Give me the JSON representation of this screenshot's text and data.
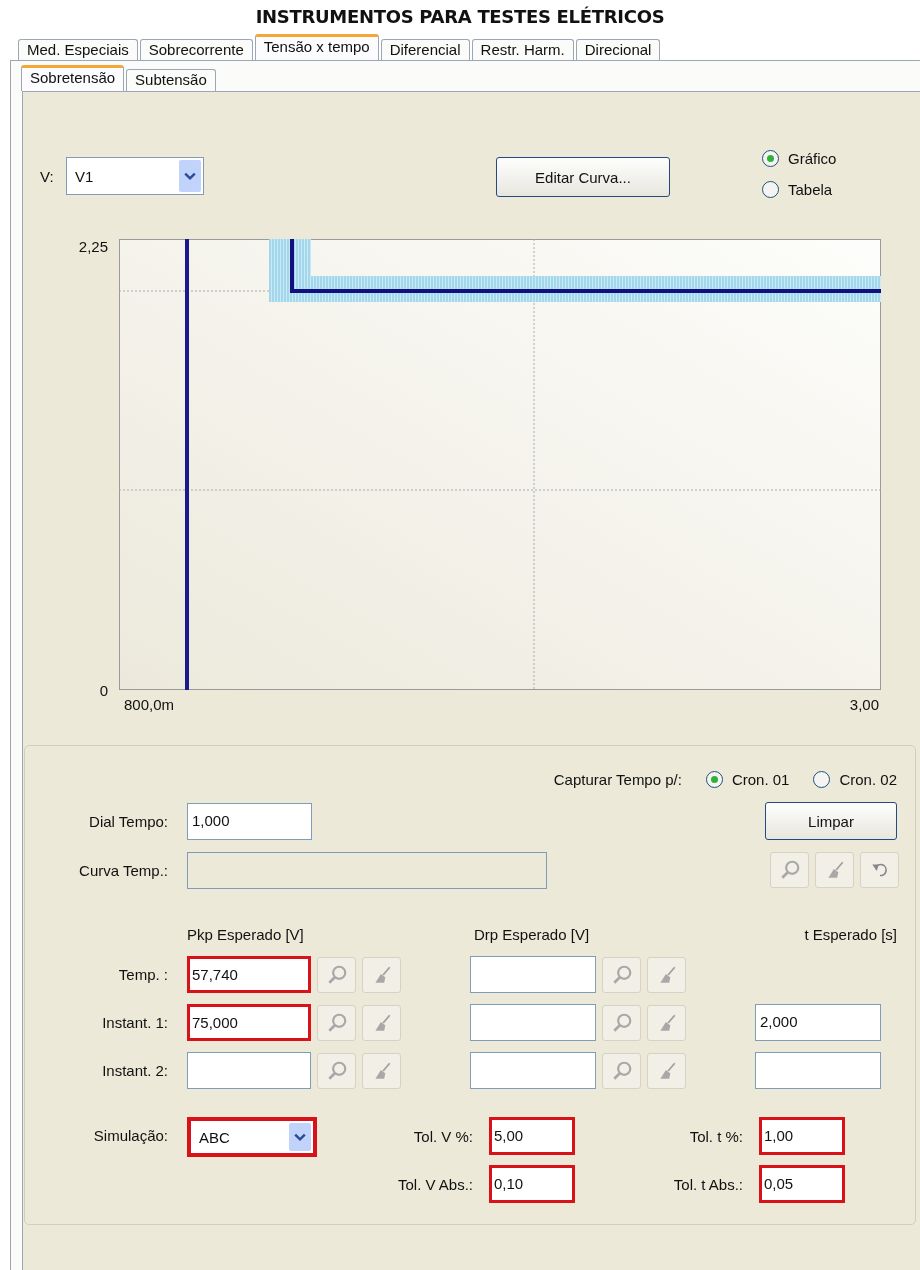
{
  "title": "INSTRUMENTOS PARA TESTES ELÉTRICOS",
  "tabs": [
    {
      "label": "Med. Especiais",
      "selected": false
    },
    {
      "label": "Sobrecorrente",
      "selected": false
    },
    {
      "label": "Tensão x tempo",
      "selected": true
    },
    {
      "label": "Diferencial",
      "selected": false
    },
    {
      "label": "Restr. Harm.",
      "selected": false
    },
    {
      "label": "Direcional",
      "selected": false
    }
  ],
  "subtabs": [
    {
      "label": "Sobretensão",
      "selected": true
    },
    {
      "label": "Subtensão",
      "selected": false
    }
  ],
  "voltage_select": {
    "label": "V:",
    "value": "V1"
  },
  "edit_curve_button": "Editar Curva...",
  "view_mode": [
    {
      "label": "Gráfico",
      "selected": true
    },
    {
      "label": "Tabela",
      "selected": false
    }
  ],
  "chart": {
    "y_axis_labels": [
      "2,25",
      "0"
    ],
    "x_axis_labels": [
      "800,0m",
      "3,00"
    ]
  },
  "capture": {
    "label": "Capturar Tempo p/:",
    "options": [
      {
        "label": "Cron. 01",
        "selected": true
      },
      {
        "label": "Cron. 02",
        "selected": false
      }
    ]
  },
  "dial": {
    "label": "Dial Tempo:",
    "value": "1,000"
  },
  "clear_button": "Limpar",
  "curve": {
    "label": "Curva Temp.:",
    "disabled": true
  },
  "columns": [
    "Pkp Esperado [V]",
    "Drp Esperado [V]",
    "t Esperado [s]"
  ],
  "rows": [
    {
      "label": "Temp. :",
      "pickup": {
        "value": "57,740",
        "highlighted": true
      },
      "dropout": {
        "highlighted": false
      }
    },
    {
      "label": "Instant. 1:",
      "pickup": {
        "value": "75,000",
        "highlighted": true
      },
      "dropout": {
        "highlighted": false
      },
      "time": {
        "value": "2,000",
        "highlighted": false
      }
    },
    {
      "label": "Instant. 2:",
      "pickup": {
        "highlighted": false
      },
      "dropout": {
        "highlighted": false
      },
      "time": {
        "highlighted": false
      }
    }
  ],
  "simulation": {
    "label": "Simulação:",
    "value": "ABC",
    "highlighted": true
  },
  "tolerances": [
    {
      "label": "Tol. V %:",
      "value": "5,00",
      "highlighted": true
    },
    {
      "label": "Tol. t %:",
      "value": "1,00",
      "highlighted": true
    },
    {
      "label": "Tol. V Abs.:",
      "value": "0,10",
      "highlighted": true
    },
    {
      "label": "Tol. t Abs.:",
      "value": "0,05",
      "highlighted": true
    }
  ]
}
